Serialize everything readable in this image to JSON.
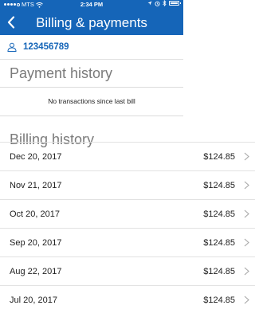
{
  "status_bar": {
    "carrier": "MTS",
    "time": "2:34 PM"
  },
  "nav": {
    "title": "Billing & payments"
  },
  "account": {
    "number": "123456789"
  },
  "payment_history": {
    "title": "Payment history",
    "empty_message": "No transactions since last bill"
  },
  "billing_history": {
    "title": "Billing history",
    "rows": [
      {
        "date": "Dec 20, 2017",
        "amount": "$124.85"
      },
      {
        "date": "Nov 21, 2017",
        "amount": "$124.85"
      },
      {
        "date": "Oct 20, 2017",
        "amount": "$124.85"
      },
      {
        "date": "Sep 20, 2017",
        "amount": "$124.85"
      },
      {
        "date": "Aug 22, 2017",
        "amount": "$124.85"
      },
      {
        "date": "Jul 20, 2017",
        "amount": "$124.85"
      }
    ]
  },
  "colors": {
    "brand": "#1565b8",
    "muted_heading": "#7a7a7a"
  }
}
